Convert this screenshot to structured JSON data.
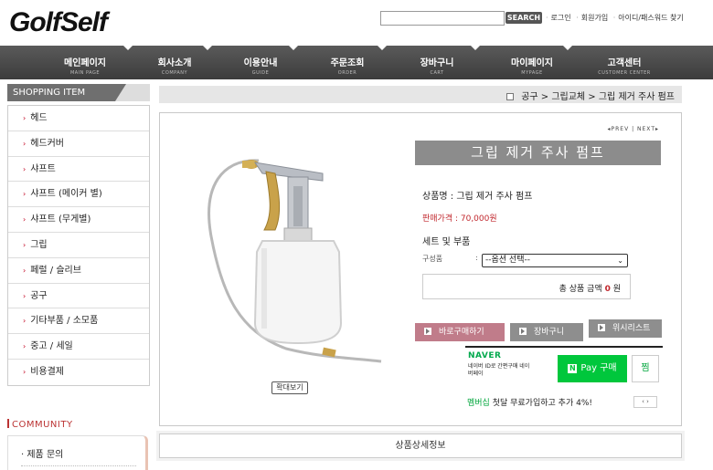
{
  "header": {
    "logo": "GolfSelf",
    "search_button": "SEARCH",
    "links": [
      "로그인",
      "회원가입",
      "아이디/패스워드 찾기"
    ]
  },
  "nav": [
    {
      "ko": "메인페이지",
      "en": "MAIN PAGE"
    },
    {
      "ko": "회사소개",
      "en": "COMPANY"
    },
    {
      "ko": "이용안내",
      "en": "GUIDE"
    },
    {
      "ko": "주문조회",
      "en": "ORDER"
    },
    {
      "ko": "장바구니",
      "en": "CART"
    },
    {
      "ko": "마이페이지",
      "en": "MYPAGE"
    },
    {
      "ko": "고객센터",
      "en": "CUSTOMER CENTER"
    }
  ],
  "sidebar": {
    "title": "SHOPPING ITEM",
    "items": [
      "헤드",
      "헤드커버",
      "샤프트",
      "샤프트 (메이커 별)",
      "샤프트 (무게별)",
      "그립",
      "페럴 / 슬리브",
      "공구",
      "기타부품 / 소모품",
      "중고 / 세일",
      "비용결제"
    ],
    "community_title": "COMMUNITY",
    "community_items": [
      "제품 문의"
    ]
  },
  "breadcrumb": "공구 > 그립교체 > 그립 제거 주사 펌프",
  "product": {
    "prev_next": "◂PREV | NEXT▸",
    "title": "그립 제거 주사 펌프",
    "name_line": "상품명 : 그립 제거 주사 펌프",
    "price_line": "판매가격 : 70,000원",
    "set_label": "세트 및 부품",
    "option_label": "구성품",
    "option_colon": ":",
    "option_selected": "--옵션 선택--",
    "total_prefix": "총 상품 금액",
    "total_amount": "0",
    "total_unit": "원",
    "zoom_button": "확대보기",
    "buy_button": "바로구매하기",
    "cart_button": "장바구니",
    "wish_button": "위시리스트"
  },
  "naverpay": {
    "brand": "NAVER",
    "desc": "네이버 ID로 간편구매 네이버페이",
    "pay_button": "Pay 구매",
    "pay_n": "N",
    "zzim": "찜",
    "member_g": "멤버십",
    "member_rest": " 첫달 무료가입하고 추가 4%!",
    "member_nav": "‹ ›"
  },
  "detail_tab": "상품상세정보",
  "colors": {
    "nav_bg": "#4a4a4a",
    "title_bg": "#8c8c8c",
    "price": "#c1272d",
    "buy": "#c07c8a",
    "naver": "#00c73c"
  }
}
